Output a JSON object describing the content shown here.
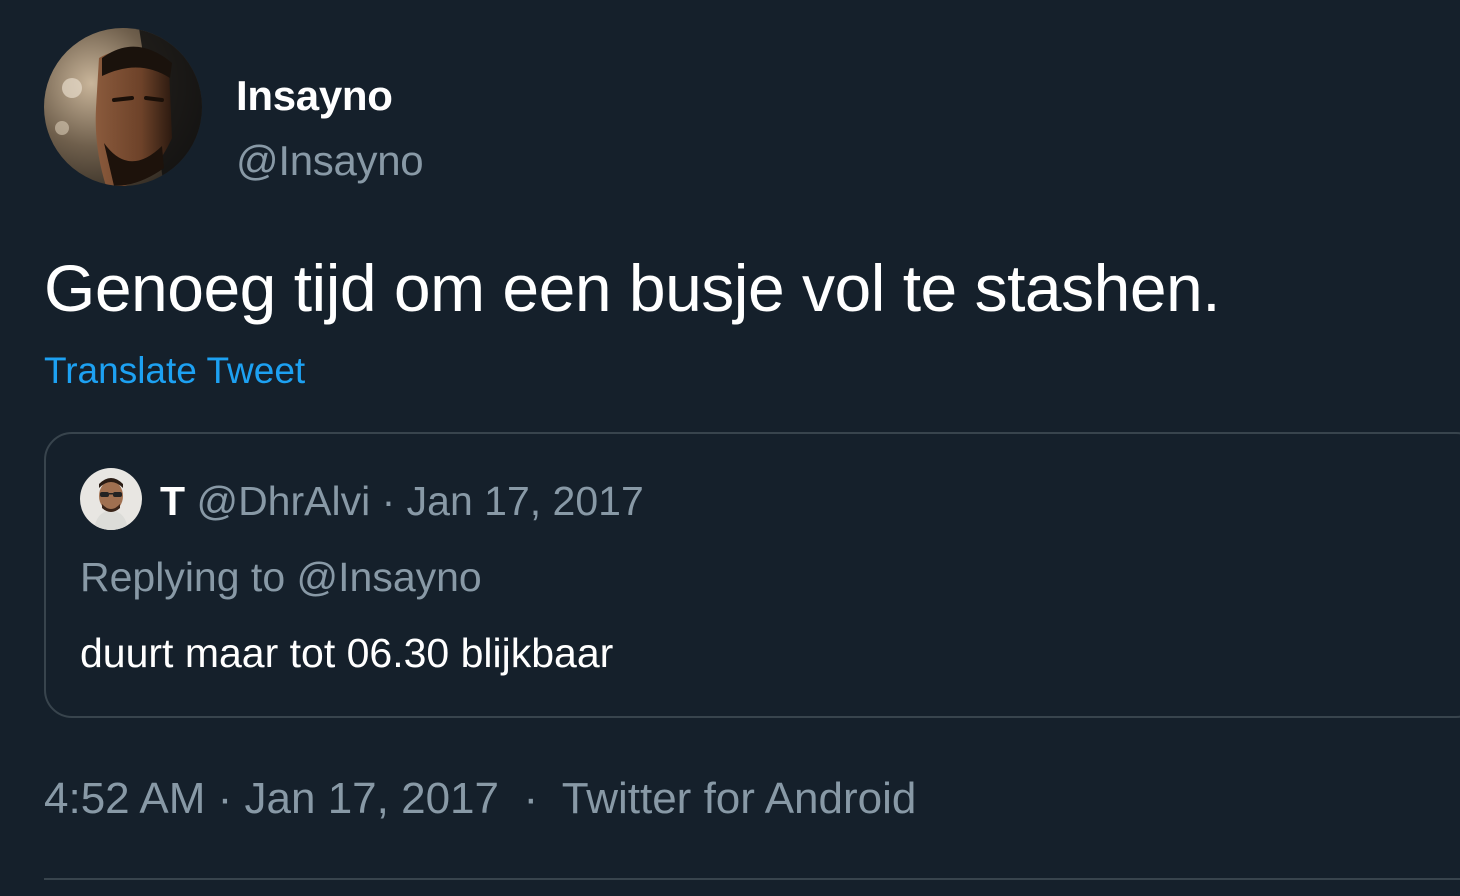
{
  "tweet": {
    "author": {
      "display_name": "Insayno",
      "handle": "@Insayno"
    },
    "text": "Genoeg tijd om een busje vol te stashen.",
    "translate_label": "Translate Tweet",
    "quoted": {
      "name": "T",
      "handle": "@DhrAlvi",
      "separator": "·",
      "date": "Jan 17, 2017",
      "replying_to": "Replying to @Insayno",
      "text": "duurt maar tot 06.30 blijkbaar"
    },
    "meta": {
      "time": "4:52 AM",
      "sep1": " · ",
      "date": "Jan 17, 2017",
      "sep2": "  ·  ",
      "source": "Twitter for Android"
    }
  },
  "colors": {
    "background": "#15202b",
    "primary_text": "#ffffff",
    "secondary_text": "#8899a6",
    "link": "#1da1f2",
    "border": "#38444d"
  }
}
